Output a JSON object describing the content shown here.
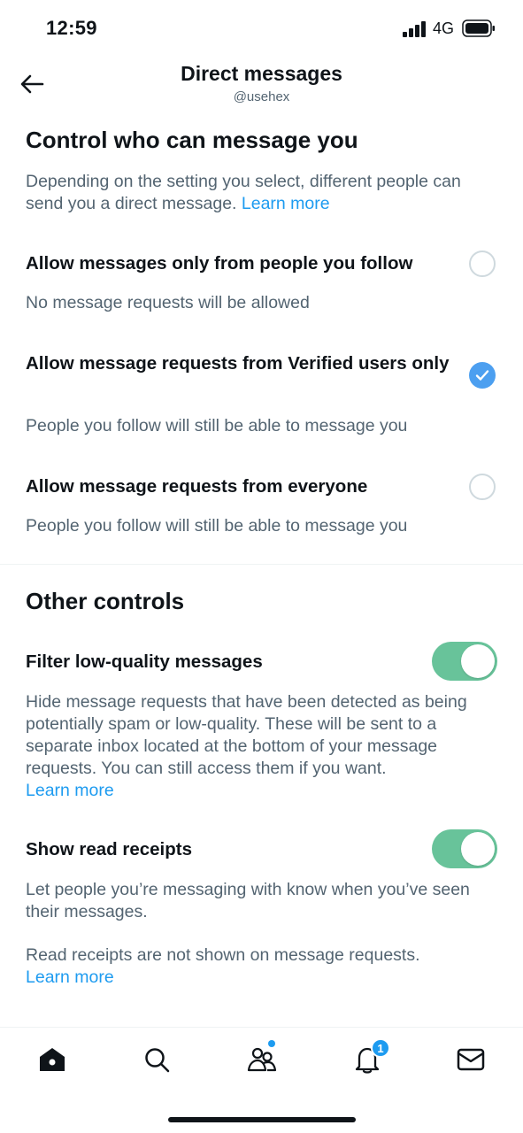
{
  "status_bar": {
    "time": "12:59",
    "network": "4G"
  },
  "header": {
    "title": "Direct messages",
    "subtitle": "@usehex"
  },
  "control_section": {
    "title": "Control who can message you",
    "description": "Depending on the setting you select, different people can send you a direct message.",
    "learn_more": "Learn more",
    "options": [
      {
        "label": "Allow messages only from people you follow",
        "sub": "No message requests will be allowed",
        "selected": false
      },
      {
        "label": "Allow message requests from Verified users only",
        "sub": "People you follow will still be able to message you",
        "selected": true
      },
      {
        "label": "Allow message requests from everyone",
        "sub": "People you follow will still be able to message you",
        "selected": false
      }
    ]
  },
  "other_section": {
    "title": "Other controls",
    "filter": {
      "label": "Filter low-quality messages",
      "description": "Hide message requests that have been detected as being potentially spam or low-quality. These will be sent to a separate inbox located at the bottom of your message requests. You can still access them if you want.",
      "learn_more": "Learn more",
      "enabled": true
    },
    "read_receipts": {
      "label": "Show read receipts",
      "description": "Let people you’re messaging with know when you’ve seen their messages.",
      "note": "Read receipts are not shown on message requests.",
      "learn_more": "Learn more",
      "enabled": true
    }
  },
  "bottom_nav": {
    "items": [
      "home-icon",
      "search-icon",
      "communities-icon",
      "notifications-icon",
      "messages-icon"
    ],
    "notification_count": "1"
  },
  "colors": {
    "accent": "#1d9bf0",
    "toggle_on": "#68c39a",
    "secondary_text": "#536471"
  }
}
